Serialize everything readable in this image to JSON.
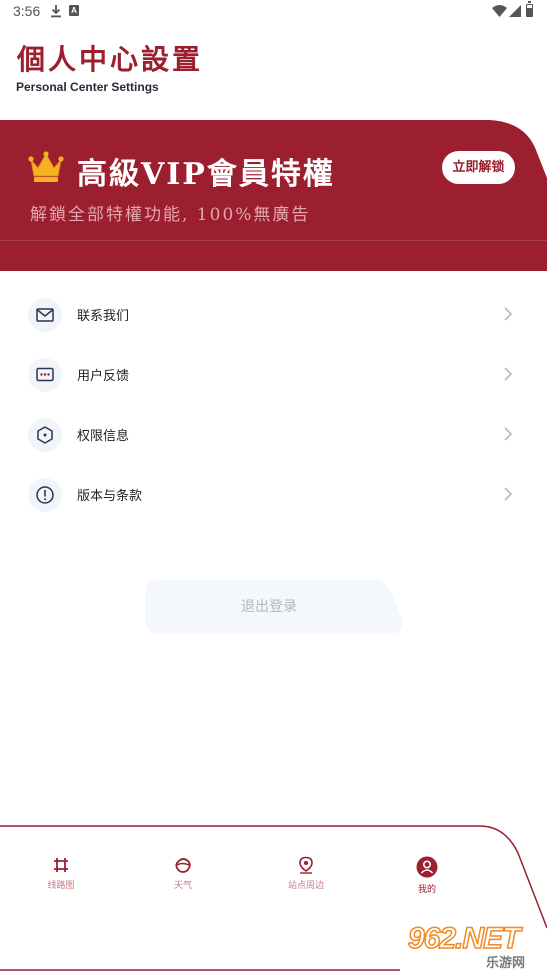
{
  "status_bar": {
    "time": "3:56",
    "notification_letter": "A"
  },
  "header": {
    "title": "個人中心設置",
    "subtitle": "Personal Center Settings"
  },
  "vip": {
    "title": "高級VIP會員特權",
    "subtitle": "解鎖全部特權功能, 100%無廣告",
    "button_label": "立即解锁",
    "crown_icon": "crown-icon",
    "brand_color": "#9b1f2e"
  },
  "menu": {
    "items": [
      {
        "label": "联系我们",
        "icon": "mail-icon"
      },
      {
        "label": "用户反馈",
        "icon": "feedback-icon"
      },
      {
        "label": "权限信息",
        "icon": "shield-icon"
      },
      {
        "label": "版本与条款",
        "icon": "info-icon"
      }
    ]
  },
  "logout": {
    "label": "退出登录"
  },
  "bottom_nav": {
    "items": [
      {
        "label": "线路图",
        "icon": "route-icon",
        "active": false
      },
      {
        "label": "天气",
        "icon": "weather-icon",
        "active": false
      },
      {
        "label": "站点周边",
        "icon": "location-icon",
        "active": false
      },
      {
        "label": "我的",
        "icon": "profile-icon",
        "active": true
      }
    ]
  },
  "watermark": {
    "logo": "962.NET",
    "sub": "乐游网"
  }
}
